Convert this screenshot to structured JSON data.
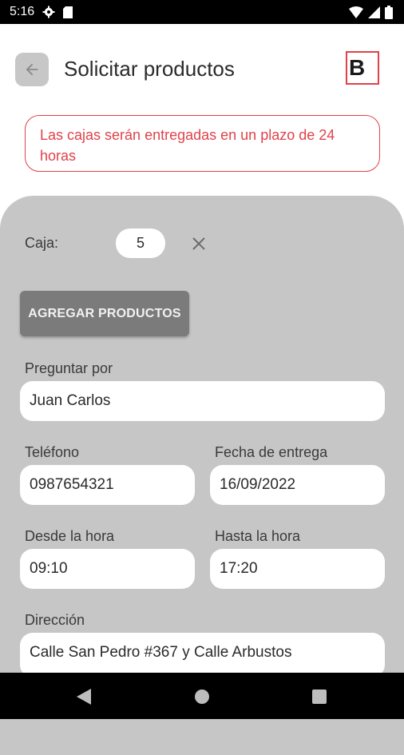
{
  "status_bar": {
    "time": "5:16",
    "icons": [
      "gear-icon",
      "sd-card-icon",
      "wifi-icon",
      "signal-icon",
      "battery-icon"
    ]
  },
  "app_bar": {
    "title": "Solicitar productos",
    "back_icon": "arrow-left-icon",
    "logo_text": "B"
  },
  "notice": {
    "text": "Las cajas serán entregadas en un plazo de 24 horas"
  },
  "form": {
    "caja_label": "Caja:",
    "caja_value": "5",
    "add_products_label": "AGREGAR PRODUCTOS",
    "preguntar_por_label": "Preguntar por",
    "preguntar_por_value": "Juan Carlos",
    "telefono_label": "Teléfono",
    "telefono_value": "0987654321",
    "fecha_entrega_label": "Fecha de entrega",
    "fecha_entrega_value": "16/09/2022",
    "desde_hora_label": "Desde la hora",
    "desde_hora_value": "09:10",
    "hasta_hora_label": "Hasta la hora",
    "hasta_hora_value": "17:20",
    "direccion_label": "Dirección",
    "direccion_value": "Calle San Pedro #367 y Calle Arbustos"
  },
  "nav_bar": {
    "icons": [
      "back-triangle-icon",
      "home-circle-icon",
      "recents-square-icon"
    ]
  },
  "colors": {
    "accent": "#e0424a",
    "panel_bg": "#c6c6c6",
    "button_bg": "#7b7b7b"
  }
}
